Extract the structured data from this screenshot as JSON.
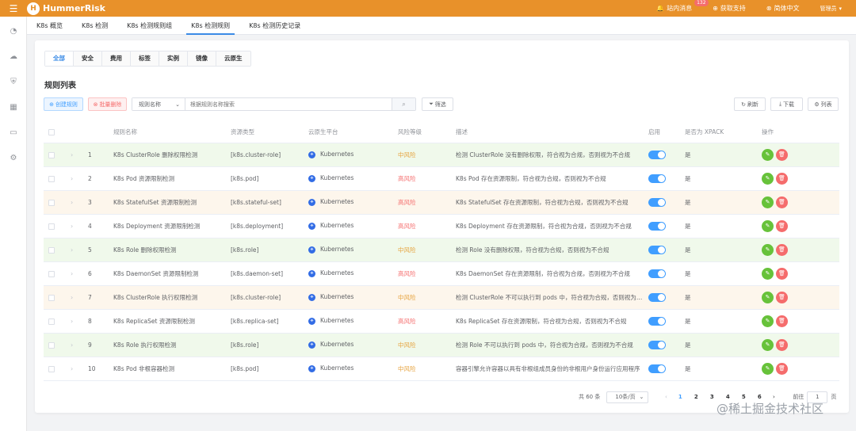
{
  "app": {
    "name": "HummerRisk",
    "logo_letter": "H"
  },
  "topbar": {
    "menu_icon": "hamburger-icon",
    "messages_label": "站内消息",
    "messages_badge": "132",
    "support_label": "获取支持",
    "language_label": "简体中文",
    "user_label": "管理员"
  },
  "sidebar": {
    "icons": [
      "dashboard-icon",
      "cloud-icon",
      "shield-icon",
      "grid-icon",
      "monitor-icon",
      "settings-icon"
    ]
  },
  "nav_tabs": [
    {
      "label": "K8s 概览",
      "active": false
    },
    {
      "label": "K8s 检测",
      "active": false
    },
    {
      "label": "K8s 检测规则组",
      "active": false
    },
    {
      "label": "K8s 检测规则",
      "active": true
    },
    {
      "label": "K8s 检测历史记录",
      "active": false
    }
  ],
  "filter_tabs": [
    {
      "label": "全部",
      "active": true
    },
    {
      "label": "安全",
      "active": false
    },
    {
      "label": "费用",
      "active": false
    },
    {
      "label": "标签",
      "active": false
    },
    {
      "label": "实例",
      "active": false
    },
    {
      "label": "镜像",
      "active": false
    },
    {
      "label": "云原生",
      "active": false
    }
  ],
  "list_title": "规则列表",
  "toolbar": {
    "create_label": "创建规则",
    "batch_delete_label": "批量删除",
    "search_field": "规则名称",
    "search_placeholder": "根据规则名称搜索",
    "filter_label": "筛选",
    "refresh_label": "刷新",
    "download_label": "下载",
    "columns_label": "列表"
  },
  "table": {
    "headers": [
      "规则名称",
      "资源类型",
      "云原生平台",
      "风险等级",
      "描述",
      "启用",
      "是否为 XPACK",
      "操作"
    ],
    "rows": [
      {
        "index": "1",
        "name": "K8s ClusterRole 删除权限检测",
        "resource": "[k8s.cluster-role]",
        "platform": "Kubernetes",
        "risk": "中风险",
        "risk_color": "#e6a23c",
        "desc": "检测 ClusterRole 没有删除权限，符合视为合规，否则视为不合规",
        "xpack": "是",
        "tone": "green"
      },
      {
        "index": "2",
        "name": "K8s Pod 资源限制检测",
        "resource": "[k8s.pod]",
        "platform": "Kubernetes",
        "risk": "高风险",
        "risk_color": "#f56c6c",
        "desc": "K8s Pod 存在资源限制，符合视为合规，否则视为不合规",
        "xpack": "是",
        "tone": "white"
      },
      {
        "index": "3",
        "name": "K8s StatefulSet 资源限制检测",
        "resource": "[k8s.stateful-set]",
        "platform": "Kubernetes",
        "risk": "高风险",
        "risk_color": "#f56c6c",
        "desc": "K8s StatefulSet 存在资源限制，符合视为合规，否则视为不合规",
        "xpack": "是",
        "tone": "orange"
      },
      {
        "index": "4",
        "name": "K8s Deployment 资源限制检测",
        "resource": "[k8s.deployment]",
        "platform": "Kubernetes",
        "risk": "高风险",
        "risk_color": "#f56c6c",
        "desc": "K8s Deployment 存在资源限制，符合视为合规，否则视为不合规",
        "xpack": "是",
        "tone": "white"
      },
      {
        "index": "5",
        "name": "K8s Role 删除权限检测",
        "resource": "[k8s.role]",
        "platform": "Kubernetes",
        "risk": "中风险",
        "risk_color": "#e6a23c",
        "desc": "检测 Role 没有删除权限，符合视为合规，否则视为不合规",
        "xpack": "是",
        "tone": "green"
      },
      {
        "index": "6",
        "name": "K8s DaemonSet 资源限制检测",
        "resource": "[k8s.daemon-set]",
        "platform": "Kubernetes",
        "risk": "高风险",
        "risk_color": "#f56c6c",
        "desc": "K8s DaemonSet 存在资源限制，符合视为合规，否则视为不合规",
        "xpack": "是",
        "tone": "white"
      },
      {
        "index": "7",
        "name": "K8s ClusterRole 执行权限检测",
        "resource": "[k8s.cluster-role]",
        "platform": "Kubernetes",
        "risk": "中风险",
        "risk_color": "#e6a23c",
        "desc": "检测 ClusterRole 不可以执行到 pods 中，符合视为合规，否则视为不合规",
        "xpack": "是",
        "tone": "orange"
      },
      {
        "index": "8",
        "name": "K8s ReplicaSet 资源限制检测",
        "resource": "[k8s.replica-set]",
        "platform": "Kubernetes",
        "risk": "高风险",
        "risk_color": "#f56c6c",
        "desc": "K8s ReplicaSet 存在资源限制，符合视为合规，否则视为不合规",
        "xpack": "是",
        "tone": "white"
      },
      {
        "index": "9",
        "name": "K8s Role 执行权限检测",
        "resource": "[k8s.role]",
        "platform": "Kubernetes",
        "risk": "中风险",
        "risk_color": "#e6a23c",
        "desc": "检测 Role 不可以执行到 pods 中，符合视为合规，否则视为不合规",
        "xpack": "是",
        "tone": "green"
      },
      {
        "index": "10",
        "name": "K8s Pod 非根容器检测",
        "resource": "[k8s.pod]",
        "platform": "Kubernetes",
        "risk": "中风险",
        "risk_color": "#e6a23c",
        "desc": "容器引擎允许容器以具有非根组成员身份的非根用户身份运行应用程序",
        "xpack": "是",
        "tone": "white"
      }
    ]
  },
  "pagination": {
    "total": "共 60 条",
    "page_size": "10条/页",
    "pages": [
      "1",
      "2",
      "3",
      "4",
      "5",
      "6"
    ],
    "current": "1",
    "goto_label": "前往",
    "goto_value": "1",
    "page_suffix": "页"
  },
  "watermark": "@稀土掘金技术社区"
}
